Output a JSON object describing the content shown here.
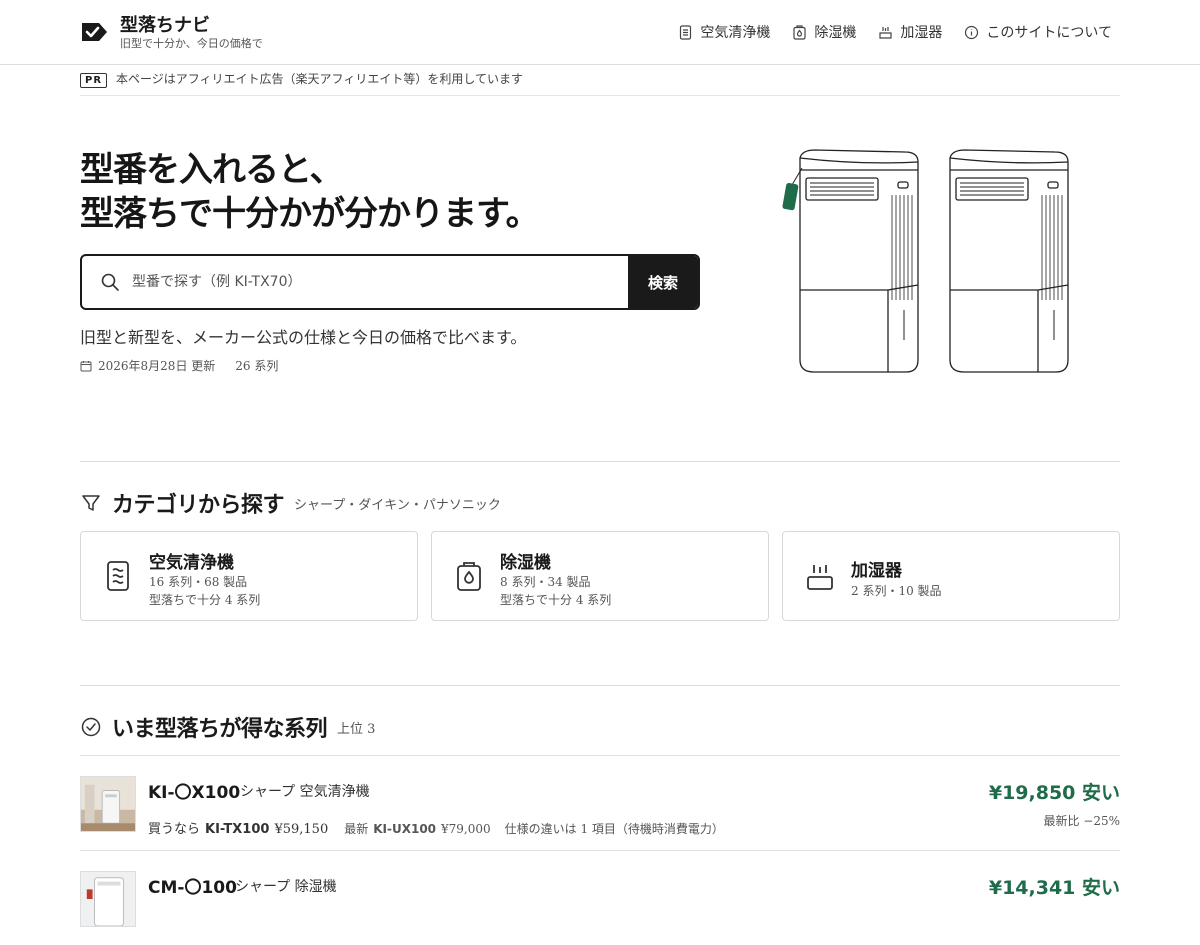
{
  "header": {
    "title": "型落ちナビ",
    "subtitle": "旧型で十分か、今日の価格で",
    "nav": [
      {
        "label": "空気清浄機",
        "icon": "air-purifier-icon"
      },
      {
        "label": "除湿機",
        "icon": "dehumidifier-icon"
      },
      {
        "label": "加湿器",
        "icon": "humidifier-icon"
      },
      {
        "label": "このサイトについて",
        "icon": "info-icon"
      }
    ]
  },
  "pr": {
    "badge": "PR",
    "text": "本ページはアフィリエイト広告（楽天アフィリエイト等）を利用しています"
  },
  "hero": {
    "title_line1": "型番を入れると、",
    "title_line2": "型落ちで十分かが分かります。",
    "search_placeholder": "型番で探す（例 KI-TX70）",
    "search_button": "検索",
    "description": "旧型と新型を、メーカー公式の仕様と今日の価格で比べます。",
    "updated": "2026年8月28日 更新",
    "series_count": "26 系列"
  },
  "categories": {
    "title": "カテゴリから探す",
    "subtitle": "シャープ・ダイキン・パナソニック",
    "items": [
      {
        "name": "空気清浄機",
        "line1": "16 系列・68 製品",
        "line2": "型落ちで十分 4 系列",
        "icon": "air-purifier-icon"
      },
      {
        "name": "除湿機",
        "line1": "8 系列・34 製品",
        "line2": "型落ちで十分 4 系列",
        "icon": "dehumidifier-icon"
      },
      {
        "name": "加湿器",
        "line1": "2 系列・10 製品",
        "line2": "",
        "icon": "humidifier-icon"
      }
    ]
  },
  "deals": {
    "title": "いま型落ちが得な系列",
    "subtitle": "上位 3",
    "items": [
      {
        "model": "KI-〇X100",
        "brand": "シャープ 空気清浄機",
        "buy_label": "買うなら",
        "buy_model": "KI-TX100",
        "buy_price": "¥59,150",
        "latest_label": "最新",
        "latest_model": "KI-UX100",
        "latest_price": "¥79,000",
        "diff": "仕様の違いは 1 項目（待機時消費電力）",
        "saving": "¥19,850 安い",
        "ratio": "最新比 −25%"
      },
      {
        "model": "CM-〇100",
        "brand": "シャープ 除湿機",
        "buy_label": "",
        "buy_model": "",
        "buy_price": "",
        "latest_label": "",
        "latest_model": "",
        "latest_price": "",
        "diff": "",
        "saving": "¥14,341 安い",
        "ratio": ""
      }
    ]
  }
}
